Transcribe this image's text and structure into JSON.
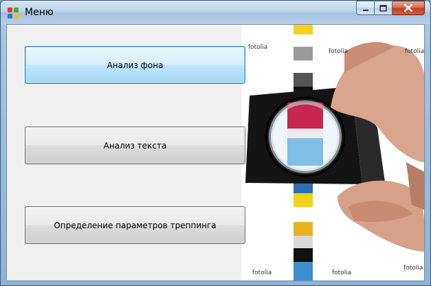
{
  "window": {
    "title": "Меню",
    "icon": "app-window-icon",
    "controls": {
      "minimize": "minimize-icon",
      "maximize": "maximize-icon",
      "close": "close-icon"
    }
  },
  "buttons": [
    {
      "label": "Анализ фона"
    },
    {
      "label": "Анализ текста"
    },
    {
      "label": "Определение параметров треппинга"
    }
  ],
  "illustration": {
    "subject": "hand holding loupe over print color bar",
    "watermark": "fotolia"
  },
  "colors": {
    "titlebar": "#bcd3ea",
    "client": "#f0f0f0",
    "close_button": "#c33a1f",
    "focused_border": "#3c7fb1"
  }
}
